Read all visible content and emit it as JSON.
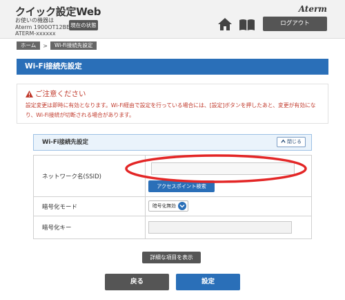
{
  "header": {
    "app_title": "クイック設定Web",
    "device_line1": "お使いの機器は",
    "device_line2": "Aterm 1900OT12BE",
    "device_line3": "ATERM-xxxxxx",
    "status_button": "現在の状態",
    "brand": "Aterm",
    "home_icon": "home-icon",
    "manual_icon": "book-icon",
    "logout_button": "ログアウト"
  },
  "breadcrumb": {
    "items": [
      "ホーム",
      "Wi-Fi接続先設定"
    ],
    "separator": ">"
  },
  "page": {
    "title": "Wi-Fi接続先設定"
  },
  "notice": {
    "title": "ご注意ください",
    "text": "設定変更は即時に有効となります。Wi-Fi経由で設定を行っている場合には、[設定]ボタンを押したあと、変更が有効になり、Wi-Fi接続が切断される場合があります。"
  },
  "section": {
    "title": "Wi-Fi接続先設定",
    "collapse_button": "閉じる"
  },
  "form": {
    "ssid_label": "ネットワーク名(SSID)",
    "ssid_value": "",
    "scan_button": "アクセスポイント検索",
    "encryption_label": "暗号化モード",
    "encryption_value": "暗号化無効",
    "key_label": "暗号化キー",
    "key_value": ""
  },
  "actions": {
    "detail_button": "詳細な項目を表示",
    "back_button": "戻る",
    "save_button": "設定"
  },
  "colors": {
    "accent_blue": "#2a6fb8",
    "dark_button": "#555555",
    "warning_red": "#c0392b",
    "highlight_red": "#e32626"
  }
}
